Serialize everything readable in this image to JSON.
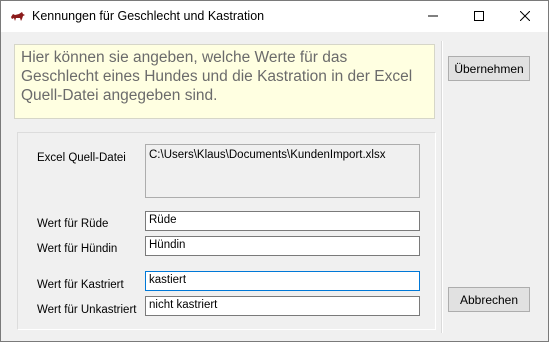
{
  "window": {
    "title": "Kennungen für Geschlecht und Kastration",
    "icon": "dog-app-icon",
    "controls": [
      "minimize-icon",
      "maximize-icon",
      "close-icon"
    ]
  },
  "info": {
    "text": "Hier können sie angeben, welche Werte für das Geschlecht eines Hundes und die Kastration in der Excel Quell-Datei angegeben sind."
  },
  "buttons": {
    "ok_label": "Übernehmen",
    "cancel_label": "Abbrechen"
  },
  "source": {
    "label": "Excel Quell-Datei",
    "path": "C:\\Users\\Klaus\\Documents\\KundenImport.xlsx"
  },
  "fields": {
    "ruede": {
      "label": "Wert für Rüde",
      "value": "Rüde"
    },
    "huendin": {
      "label": "Wert für Hündin",
      "value": "Hündin"
    },
    "kastriert": {
      "label": "Wert für Kastriert",
      "value": "kastiert"
    },
    "unkastriert": {
      "label": "Wert für Unkastriert",
      "value": "nicht kastriert"
    }
  },
  "colors": {
    "info_background": "#ffffe1",
    "info_text": "#6b6b6b",
    "focus_border": "#0078d7"
  }
}
